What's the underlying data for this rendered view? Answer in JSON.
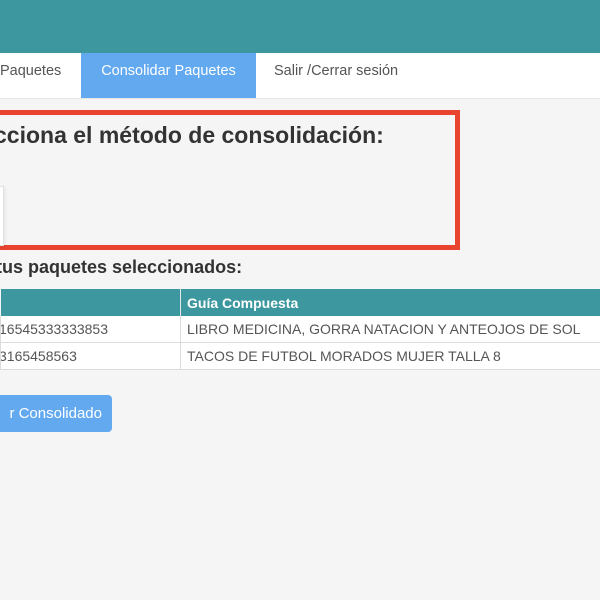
{
  "nav": {
    "items": [
      {
        "label": "Paquetes",
        "active": false
      },
      {
        "label": "Consolidar Paquetes",
        "active": true
      },
      {
        "label": "Salir /Cerrar sesión",
        "active": false
      }
    ]
  },
  "consolidation": {
    "title": "cciona el método de consolidación:"
  },
  "selected": {
    "title": "tus paquetes seleccionados:",
    "table": {
      "headers": [
        "",
        "Guía Compuesta"
      ],
      "rows": [
        [
          "16545333333853",
          "LIBRO MEDICINA, GORRA NATACION Y ANTEOJOS DE SOL"
        ],
        [
          "3165458563",
          "TACOS DE FUTBOL MORADOS MUJER TALLA 8"
        ]
      ]
    }
  },
  "actions": {
    "confirm_label": "r Consolidado"
  },
  "colors": {
    "header_teal": "#3c979f",
    "accent_blue": "#62a9f0",
    "highlight_red": "#e8442f"
  }
}
